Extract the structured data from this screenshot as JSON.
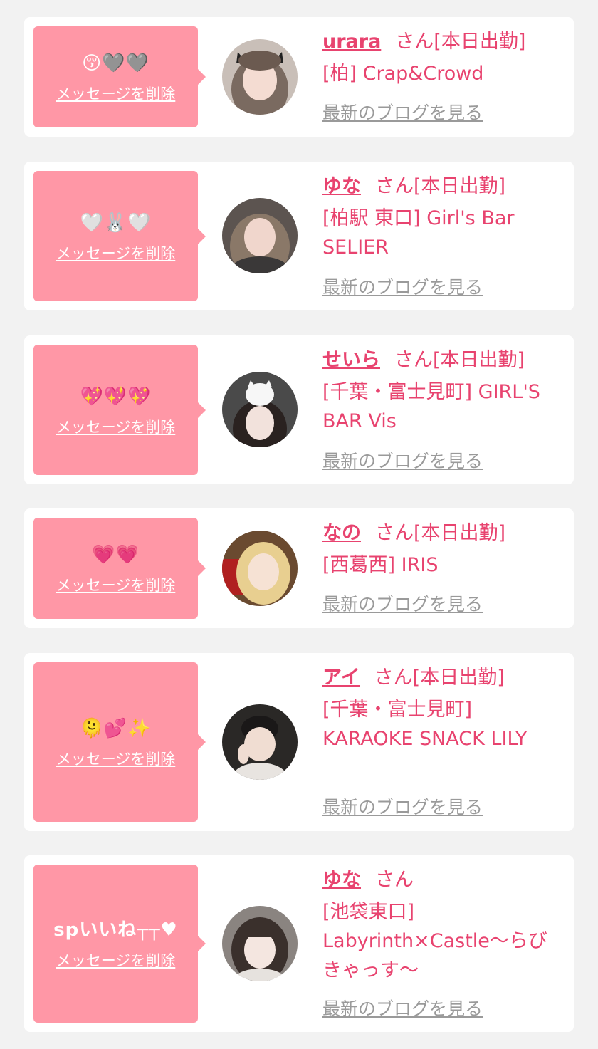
{
  "delete_label": "メッセージを削除",
  "san_suffix": "さん",
  "blog_label": "最新のブログを見る",
  "cards": [
    {
      "message": "😚🩶🩶",
      "name": "urara",
      "status": "[本日出勤]",
      "shop": "[柏] Crap&Crowd"
    },
    {
      "message": "🤍🐰🤍",
      "name": "ゆな",
      "status": "[本日出勤]",
      "shop": "[柏駅 東口] Girl's Bar SELIER"
    },
    {
      "message": "💖💖💖",
      "name": "せいら",
      "status": "[本日出勤]",
      "shop": "[千葉・富士見町] GIRL'S BAR Vis"
    },
    {
      "message": "💗💗",
      "name": "なの",
      "status": "[本日出勤]",
      "shop": "[西葛西] IRIS"
    },
    {
      "message": "🫠💕✨",
      "name": "アイ",
      "status": "[本日出勤]",
      "shop": "[千葉・富士見町] KARAOKE SNACK LILY"
    },
    {
      "message": "spいいね┬┬♥",
      "name": "ゆな",
      "status": "",
      "shop": "[池袋東口] Labyrinth×Castle〜らびきゃっす〜"
    }
  ]
}
